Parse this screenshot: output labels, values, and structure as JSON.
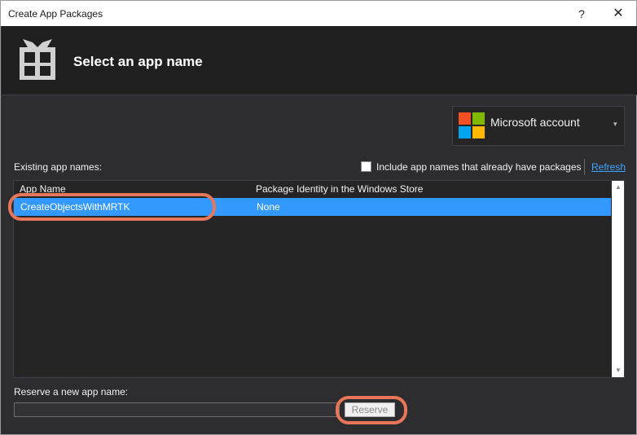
{
  "window": {
    "title": "Create App Packages",
    "help_label": "?",
    "close_label": "✕"
  },
  "header": {
    "title": "Select an app name",
    "icon": "gift-package-icon"
  },
  "account": {
    "label": "Microsoft account",
    "icon": "microsoft-logo-icon",
    "caret": "▾",
    "logo_colors": [
      "#f25022",
      "#7fba00",
      "#00a4ef",
      "#ffb900"
    ]
  },
  "existing": {
    "label": "Existing app names:",
    "include_label": "Include app names that already have packages",
    "include_checked": false,
    "refresh_label": "Refresh"
  },
  "table": {
    "columns": [
      "App Name",
      "Package Identity in the Windows Store"
    ],
    "rows": [
      {
        "app_name": "CreateObjectsWithMRTK",
        "identity": "None",
        "selected": true
      }
    ]
  },
  "scrollbar": {
    "up": "▲",
    "down": "▼"
  },
  "reserve": {
    "label": "Reserve a new app name:",
    "value": "",
    "button_label": "Reserve"
  },
  "colors": {
    "selection": "#3399ff",
    "highlight": "#e8775a",
    "link": "#3ea6ff"
  }
}
